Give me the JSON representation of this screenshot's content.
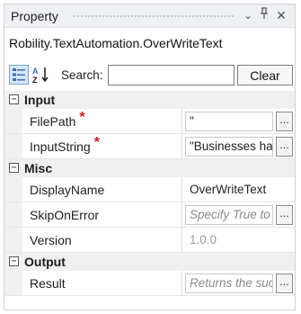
{
  "panel": {
    "title": "Property",
    "dropdown_glyph": "⌄",
    "pin_glyph": "⊥",
    "close_glyph": "✕"
  },
  "activity": {
    "class_name": "Robility.TextAutomation.OverWriteText"
  },
  "toolbar": {
    "categorized_icon": "categorized-view-icon",
    "alphabetical_icon": "sort-alphabetical-icon",
    "search_label": "Search:",
    "search_value": "",
    "clear_label": "Clear"
  },
  "categories": [
    {
      "label": "Input",
      "toggle": "⊟",
      "properties": [
        {
          "name": "FilePath",
          "required": "*",
          "value": "\"",
          "ellipsis": "..."
        },
        {
          "name": "InputString",
          "required": "*",
          "value": "\"Businesses ha",
          "ellipsis": "..."
        }
      ]
    },
    {
      "label": "Misc",
      "toggle": "⊟",
      "properties": [
        {
          "name": "DisplayName",
          "value": "OverWriteText"
        },
        {
          "name": "SkipOnError",
          "placeholder": "Specify True to",
          "ellipsis": "..."
        },
        {
          "name": "Version",
          "value": "1.0.0"
        }
      ]
    },
    {
      "label": "Output",
      "toggle": "⊟",
      "properties": [
        {
          "name": "Result",
          "placeholder": "Returns the suc",
          "ellipsis": "..."
        }
      ]
    }
  ]
}
